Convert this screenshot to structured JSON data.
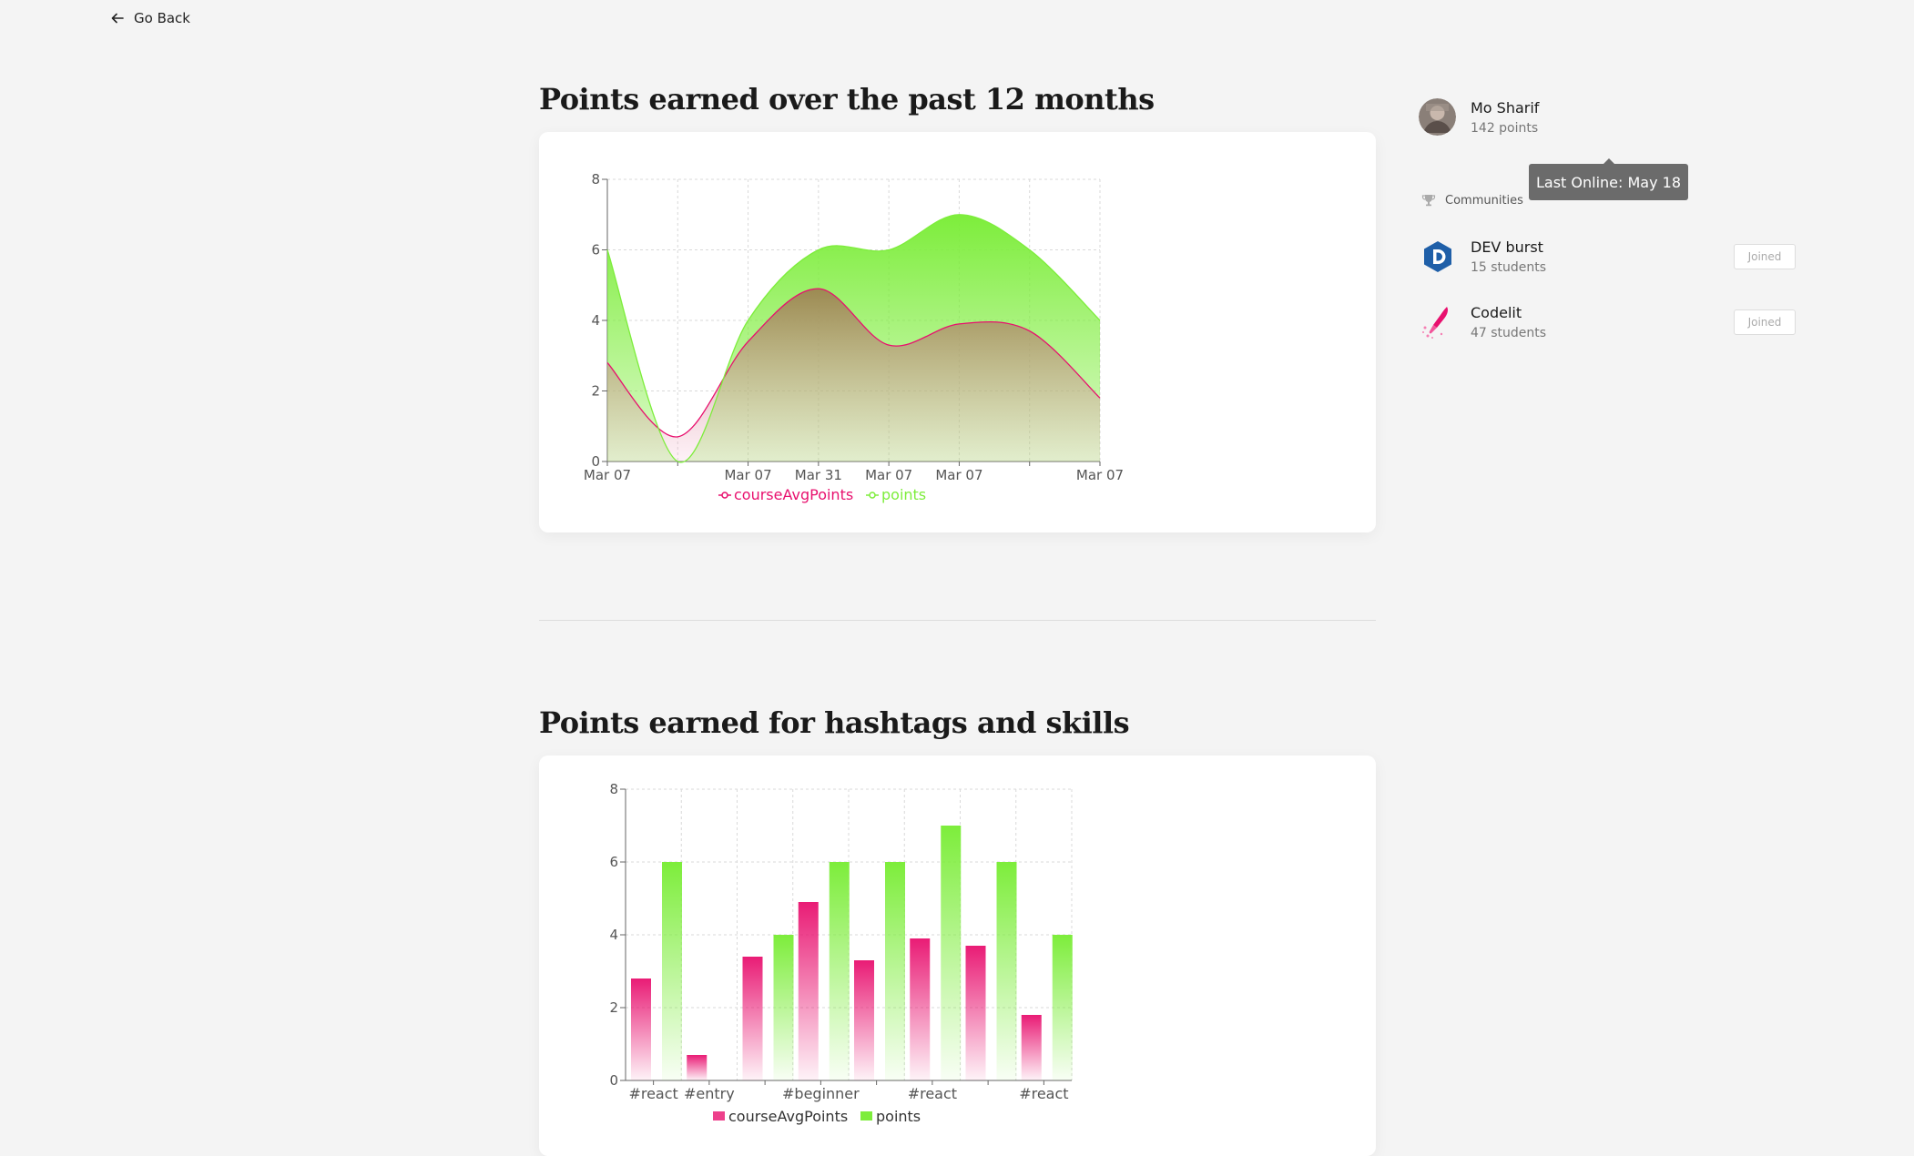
{
  "nav": {
    "back_label": "Go Back"
  },
  "sections": {
    "line_title": "Points earned over the past 12 months",
    "bar_title": "Points earned for hashtags and skills"
  },
  "profile": {
    "name": "Mo Sharif",
    "points": "142 points",
    "tooltip": "Last Online: May 18"
  },
  "communities": {
    "heading": "Communities",
    "items": [
      {
        "name": "DEV burst",
        "students": "15 students",
        "status": "Joined",
        "icon": "dev-logo-icon"
      },
      {
        "name": "Codelit",
        "students": "47 students",
        "status": "Joined",
        "icon": "codelit-logo-icon"
      }
    ]
  },
  "colors": {
    "course": "#e8106e",
    "points": "#7ded3b",
    "mix": "#9c8a52"
  },
  "chart_data": [
    {
      "type": "area",
      "xlabels": [
        "Mar 07",
        "",
        "Mar 07",
        "Mar 31",
        "Mar 07",
        "Mar 07",
        "",
        "Mar 07"
      ],
      "yticks": [
        "0",
        "2",
        "4",
        "6",
        "8"
      ],
      "ylim": [
        0,
        8
      ],
      "series": [
        {
          "name": "courseAvgPoints",
          "values": [
            2.8,
            0.7,
            3.4,
            4.9,
            3.3,
            3.9,
            3.7,
            1.8
          ]
        },
        {
          "name": "points",
          "values": [
            6,
            0,
            4,
            6,
            6,
            7,
            6,
            4
          ]
        }
      ],
      "legend": "bottom"
    },
    {
      "type": "bar",
      "categories": [
        "#react",
        "#entry",
        "",
        "#beginner",
        "",
        "#react",
        "",
        "#react"
      ],
      "yticks": [
        "0",
        "2",
        "4",
        "6",
        "8"
      ],
      "ylim": [
        0,
        8
      ],
      "series": [
        {
          "name": "courseAvgPoints",
          "values": [
            2.8,
            0.7,
            3.4,
            4.9,
            3.3,
            3.9,
            3.7,
            1.8
          ]
        },
        {
          "name": "points",
          "values": [
            6,
            0,
            4,
            6,
            6,
            7,
            6,
            4
          ]
        }
      ],
      "legend": "bottom"
    }
  ]
}
